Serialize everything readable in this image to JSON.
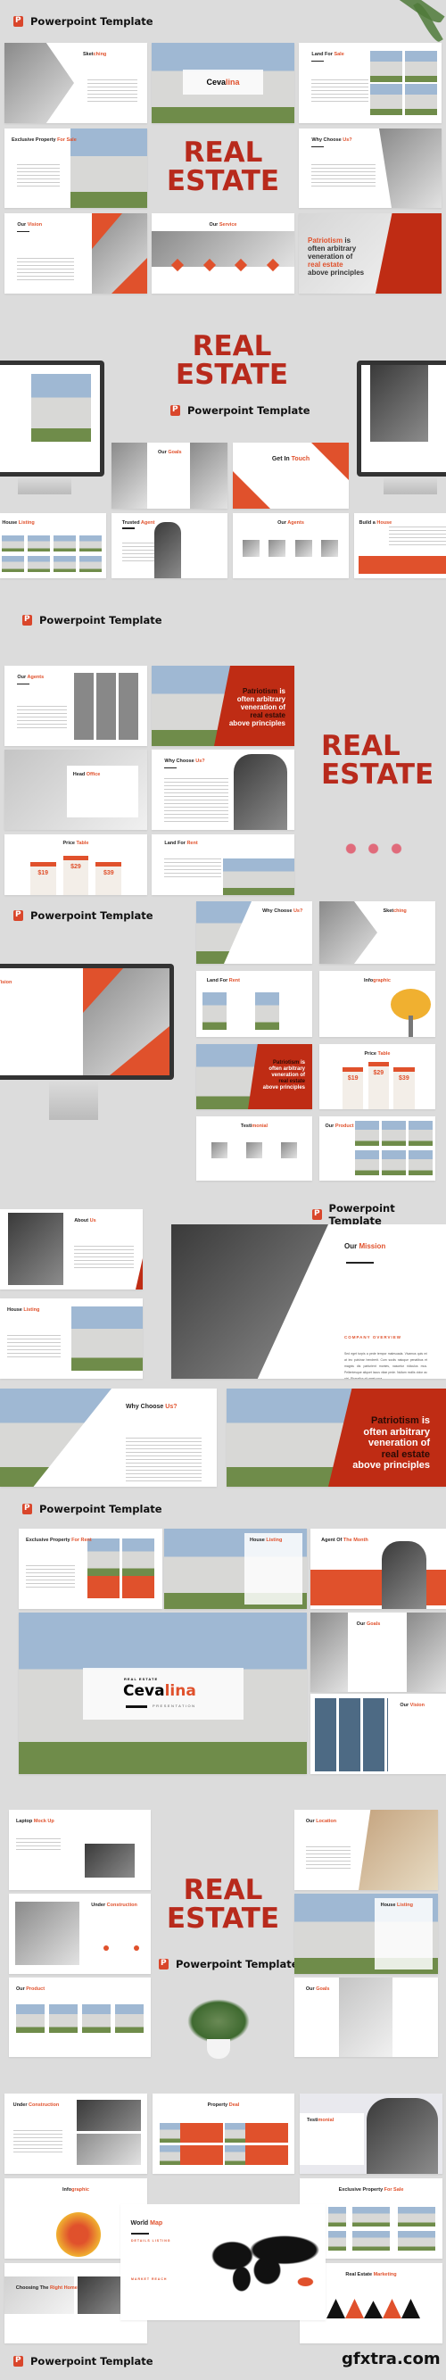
{
  "header_label": "Powerpoint Template",
  "headline": [
    "REAL",
    "ESTATE"
  ],
  "watermark": "gfxtra.com",
  "colors": {
    "background": "#dcdcdc",
    "accent": "#e0512c",
    "headline": "#b82a1c",
    "quote_panel": "#bf2c14"
  },
  "quote": {
    "accent": "Patriotism",
    "rest1": " is",
    "line2": "often arbitrary",
    "line3": "veneration of",
    "line4": "real estate",
    "line5": "above principles"
  },
  "cover": {
    "kicker": "REAL ESTATE",
    "brand_dark": "Ceva",
    "brand_accent": "lina",
    "sub": "PRESENTATION"
  },
  "prices": [
    "$19",
    "$29",
    "$39"
  ],
  "mission": {
    "dark": "Our",
    "accent": "Mission",
    "sub": "COMPANY OVERVIEW",
    "body": "Sed eget turpis a pede tempor malesuada. Vivamus quis mi at leo pulvinar hendrerit. Cum sociis natoque penatibus et magnis dis parturient montes, nascetur ridiculus mus. Pellentesque aliquet lacus vitae pede. Nullam mollis dolor ac nisi. Phasellus sit amet urna."
  },
  "worldmap": {
    "dark": "World",
    "accent": "Map",
    "sub": "DETAILS LISTING",
    "sub2": "MARKET REACH"
  },
  "slides": {
    "sketching": {
      "d": "Sket",
      "a": "ching"
    },
    "land_sale": {
      "d": "Land For",
      "a": "Sale"
    },
    "excl_sale": {
      "d": "Exclusive Property",
      "a": "For Sale"
    },
    "why": {
      "d": "Why Choose",
      "a": "Us?"
    },
    "vision": {
      "d": "Our",
      "a": "Vision"
    },
    "service": {
      "d": "Our",
      "a": "Service"
    },
    "goals": {
      "d": "Our",
      "a": "Goals"
    },
    "touch": {
      "d": "Get In",
      "a": "Touch"
    },
    "house_listing": {
      "d": "House",
      "a": "Listing"
    },
    "trusted": {
      "d": "Trusted",
      "a": "Agent"
    },
    "agents": {
      "d": "Our",
      "a": "Agents"
    },
    "build": {
      "d": "Build a",
      "a": "House"
    },
    "head_office": {
      "d": "Head",
      "a": "Office"
    },
    "price": {
      "d": "Price",
      "a": "Table"
    },
    "land_rent": {
      "d": "Land For",
      "a": "Rent"
    },
    "infographic": {
      "d": "Info",
      "a": "graphic"
    },
    "testimonial": {
      "d": "Testi",
      "a": "monial"
    },
    "product": {
      "d": "Our",
      "a": "Product"
    },
    "about": {
      "d": "About",
      "a": "Us"
    },
    "excl_rent": {
      "d": "Exclusive Property",
      "a": "For Rent"
    },
    "agent_month": {
      "d": "Agent Of",
      "a": "The Month"
    },
    "laptop": {
      "d": "Laptop",
      "a": "Mock Up"
    },
    "construction": {
      "d": "Under",
      "a": "Construction"
    },
    "location": {
      "d": "Our",
      "a": "Location"
    },
    "deal": {
      "d": "Property",
      "a": "Deal"
    },
    "choosing": {
      "d": "Choosing The",
      "a": "Right Home"
    },
    "marketing": {
      "d": "Real Estate",
      "a": "Marketing"
    }
  }
}
